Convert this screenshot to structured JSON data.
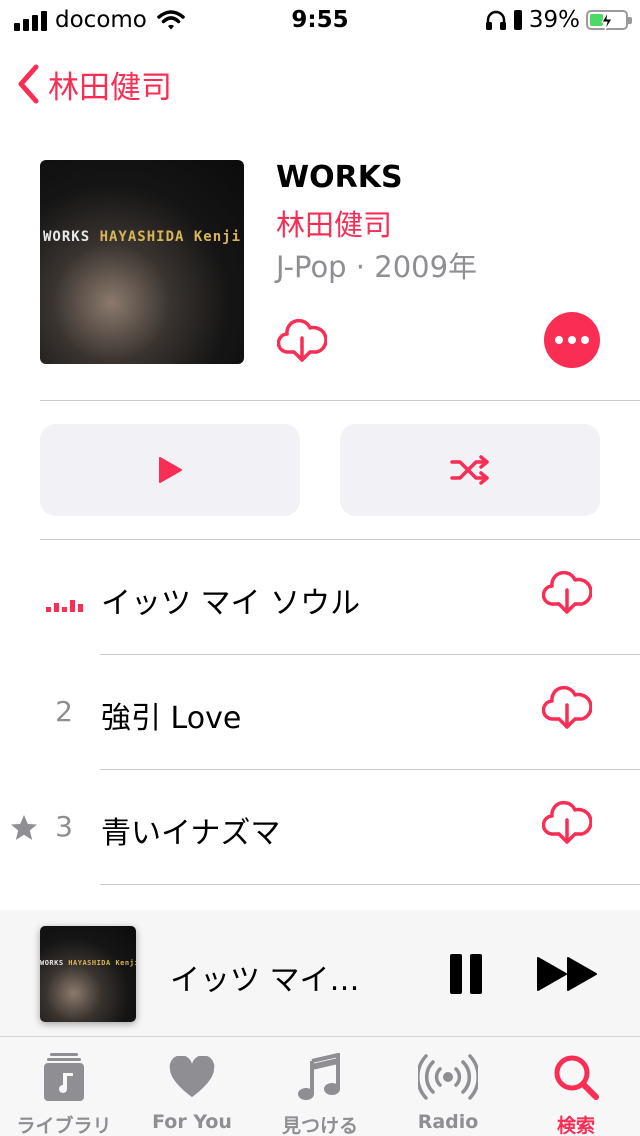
{
  "status_bar": {
    "carrier": "docomo",
    "time": "9:55",
    "battery_percent": "39%",
    "battery_level": 0.39,
    "icons": [
      "signal-icon",
      "wifi-icon",
      "headphones-icon",
      "battery-icon"
    ]
  },
  "nav": {
    "back_label": "林田健司"
  },
  "album": {
    "title": "WORKS",
    "artist": "林田健司",
    "meta": "J-Pop · 2009年",
    "cover_text_left": "WORKS",
    "cover_text_right": "HAYASHIDA Kenji"
  },
  "actions": {
    "play_icon": "play-icon",
    "shuffle_icon": "shuffle-icon",
    "download_icon": "cloud-download-icon",
    "more_icon": "more-icon"
  },
  "tracks": [
    {
      "number": "",
      "title": "イッツ マイ ソウル",
      "playing": true,
      "starred": false
    },
    {
      "number": "2",
      "title": "強引 Love",
      "playing": false,
      "starred": false
    },
    {
      "number": "3",
      "title": "青いイナズマ",
      "playing": false,
      "starred": true
    }
  ],
  "mini_player": {
    "title": "イッツ マイ…",
    "pause_icon": "pause-icon",
    "next_icon": "fast-forward-icon"
  },
  "tab_bar": {
    "tabs": [
      {
        "label": "ライブラリ",
        "icon": "library-icon",
        "active": false
      },
      {
        "label": "For You",
        "icon": "heart-icon",
        "active": false
      },
      {
        "label": "見つける",
        "icon": "music-note-icon",
        "active": false
      },
      {
        "label": "Radio",
        "icon": "radio-icon",
        "active": false
      },
      {
        "label": "検索",
        "icon": "search-icon",
        "active": true
      }
    ]
  },
  "colors": {
    "accent": "#fa2d55",
    "secondary_text": "#8e8e93",
    "button_background": "#f1f1f6"
  }
}
